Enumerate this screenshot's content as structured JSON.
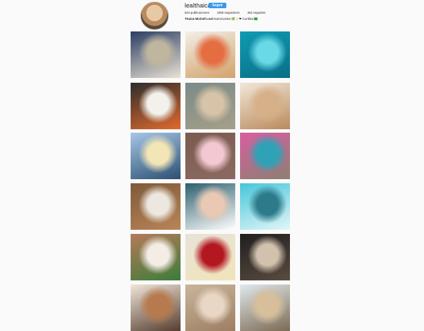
{
  "profile": {
    "username": "leaIthaica",
    "follow_label": "Seguir",
    "stats": {
      "posts": "823 publicaciones",
      "followers": "335k seguidores",
      "following": "452 seguidos"
    },
    "bio_name": "Thaisa Michell Leal",
    "bio_text": "Nutricionista 🌿✨❤ Curitiba 🇧🇷"
  },
  "posts": [
    {
      "label": "building-photo",
      "colors": [
        "#2b3d63",
        "#bfb6a0",
        "#e9e2d3"
      ]
    },
    {
      "label": "food-plate-photo",
      "colors": [
        "#f3efe8",
        "#e56d42",
        "#d1a26a"
      ]
    },
    {
      "label": "underwater-swim-photo",
      "colors": [
        "#0f9bb3",
        "#6ad9e7",
        "#0a6f88"
      ]
    },
    {
      "label": "bowl-fruit-photo",
      "colors": [
        "#2d2d2d",
        "#f3f1ec",
        "#e06a2d"
      ]
    },
    {
      "label": "selfie-blonde-photo",
      "colors": [
        "#7a8a88",
        "#d7c3a7",
        "#a6a089"
      ]
    },
    {
      "label": "smiling-selfie-photo",
      "colors": [
        "#f2e7d8",
        "#d6b088",
        "#b98a5d"
      ]
    },
    {
      "label": "sunset-sea-photo",
      "colors": [
        "#a6c7e6",
        "#f3e6b6",
        "#2c4f72"
      ]
    },
    {
      "label": "two-friends-photo",
      "colors": [
        "#7a5b4f",
        "#f3c8d2",
        "#8c6a63"
      ]
    },
    {
      "label": "two-people-floral-photo",
      "colors": [
        "#d85fa1",
        "#2fa2b8",
        "#8e7f71"
      ]
    },
    {
      "label": "pancakes-photo",
      "colors": [
        "#7e5a3a",
        "#ece7df",
        "#b98557"
      ]
    },
    {
      "label": "coffee-legs-photo",
      "colors": [
        "#2d5f6f",
        "#e9c9b4",
        "#ffffff"
      ]
    },
    {
      "label": "girl-standing-photo",
      "colors": [
        "#45c6d9",
        "#2c7a8a",
        "#e3f6f8"
      ]
    },
    {
      "label": "breakfast-table-photo",
      "colors": [
        "#b57a5a",
        "#f4ede6",
        "#3c7c3a"
      ]
    },
    {
      "label": "tea-cup-photo",
      "colors": [
        "#e8e3da",
        "#b3171f",
        "#f0e4b8"
      ]
    },
    {
      "label": "sitting-black-jacket-photo",
      "colors": [
        "#1f1f1f",
        "#d2c2ad",
        "#5a4b3f"
      ]
    },
    {
      "label": "donuts-photo",
      "colors": [
        "#f1e6d9",
        "#b77a4e",
        "#553d2f"
      ]
    },
    {
      "label": "selfie-close-photo",
      "colors": [
        "#c9b59b",
        "#e9d7c5",
        "#9d7e62"
      ]
    },
    {
      "label": "selfie-blonde-2-photo",
      "colors": [
        "#dfe9ec",
        "#d7bf9b",
        "#7d6a53"
      ]
    }
  ]
}
